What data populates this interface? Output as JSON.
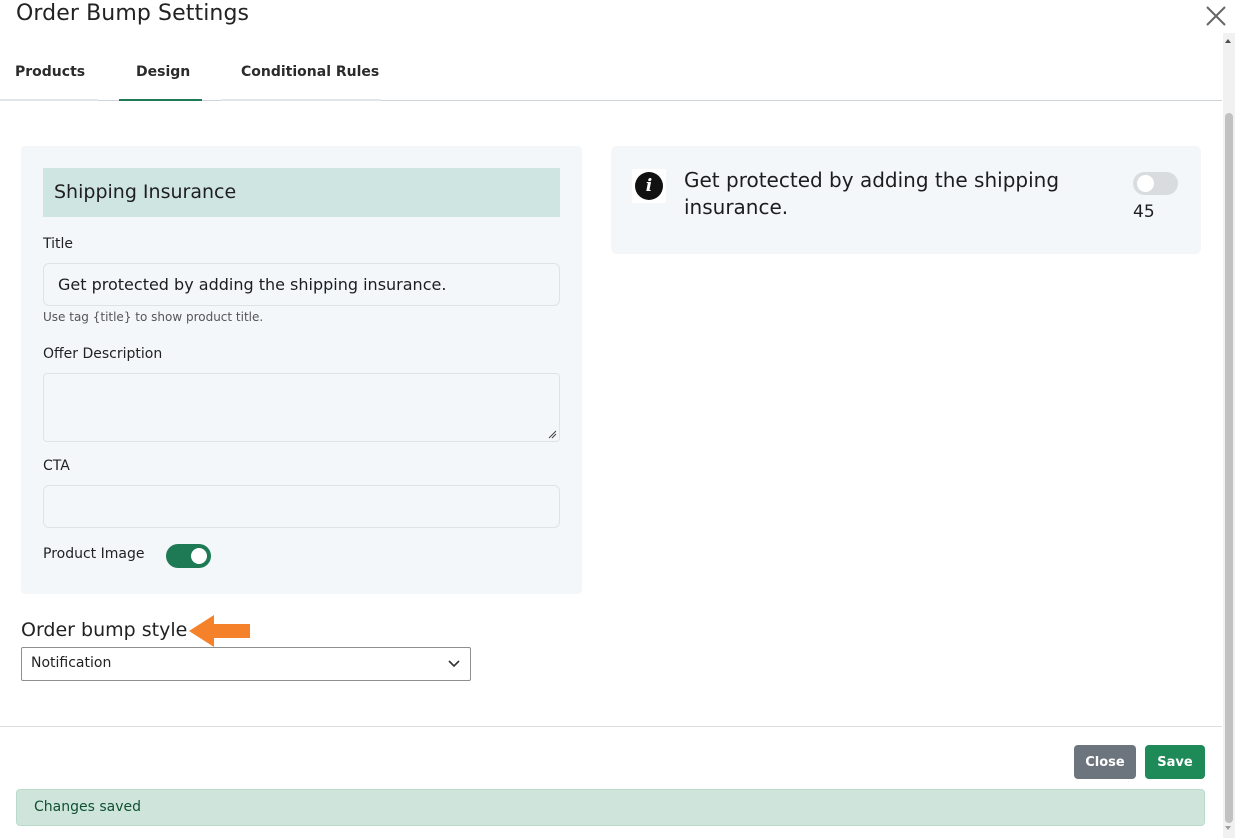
{
  "dialog": {
    "title": "Order Bump Settings"
  },
  "tabs": [
    {
      "label": "Products",
      "active": false
    },
    {
      "label": "Design",
      "active": true
    },
    {
      "label": "Conditional Rules",
      "active": false
    }
  ],
  "panel": {
    "header": "Shipping Insurance",
    "title_label": "Title",
    "title_value": "Get protected by adding the shipping insurance.",
    "title_helper": "Use tag {title} to show product title.",
    "description_label": "Offer Description",
    "description_value": "",
    "cta_label": "CTA",
    "cta_value": "",
    "product_image_label": "Product Image",
    "product_image_enabled": true
  },
  "style": {
    "label": "Order bump style",
    "selected": "Notification"
  },
  "preview": {
    "icon": "info-icon",
    "title": "Get protected by adding the shipping insurance.",
    "toggle_enabled": false,
    "count": "45"
  },
  "footer": {
    "close_label": "Close",
    "save_label": "Save"
  },
  "alert": {
    "text": "Changes saved"
  },
  "colors": {
    "accent": "#1e7a55",
    "save": "#1e8a57",
    "close": "#6c757d",
    "panel_header": "#cfe5e1",
    "alert_bg": "#cfe5dc",
    "arrow": "#f5822a"
  }
}
